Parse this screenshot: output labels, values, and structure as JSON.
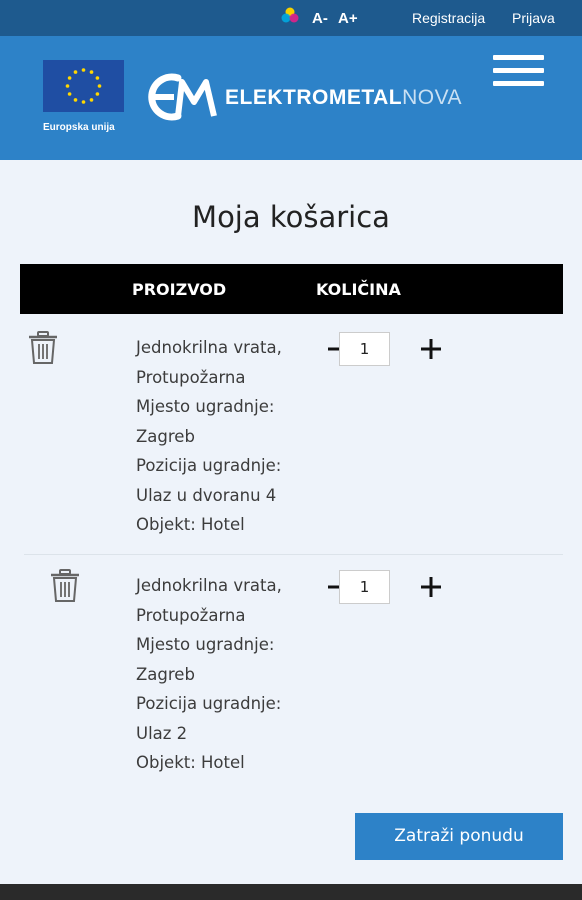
{
  "topbar": {
    "font_decrease": "A-",
    "font_increase": "A+",
    "register": "Registracija",
    "login": "Prijava"
  },
  "header": {
    "eu_caption": "Europska unija",
    "brand_main": "ELEKTROMETAL",
    "brand_suffix": "NOVA"
  },
  "cart": {
    "title": "Moja košarica",
    "col_product": "PROIZVOD",
    "col_quantity": "KOLIČINA",
    "items": [
      {
        "lines": [
          "Jednokrilna vrata,",
          "Protupožarna",
          "Mjesto ugradnje:",
          "Zagreb",
          "Pozicija ugradnje:",
          "Ulaz u dvoranu 4",
          "Objekt: Hotel"
        ],
        "quantity": "1"
      },
      {
        "lines": [
          "Jednokrilna vrata,",
          "Protupožarna",
          "Mjesto ugradnje:",
          "Zagreb",
          "Pozicija ugradnje:",
          "Ulaz 2",
          "Objekt: Hotel"
        ],
        "quantity": "1"
      }
    ],
    "submit_label": "Zatraži ponudu"
  },
  "colors": {
    "topbar": "#1e5a8e",
    "header": "#2d82c8",
    "background": "#eef3fa",
    "table_header": "#000000"
  }
}
